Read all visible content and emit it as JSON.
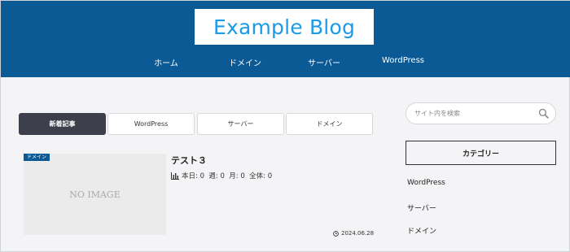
{
  "site": {
    "logo_text": "Example Blog",
    "nav": [
      "ホーム",
      "ドメイン",
      "サーバー",
      "WordPress"
    ]
  },
  "tabs": [
    {
      "label": "新着記事",
      "active": true
    },
    {
      "label": "WordPress",
      "active": false
    },
    {
      "label": "サーバー",
      "active": false
    },
    {
      "label": "ドメイン",
      "active": false
    }
  ],
  "post": {
    "category_badge": "ドメイン",
    "thumbnail_text": "NO IMAGE",
    "title": "テスト３",
    "stats": "本日: 0  週: 0  月: 0  全体: 0",
    "date": "2024.06.28"
  },
  "sidebar": {
    "search_placeholder": "サイト内を検索",
    "category_heading": "カテゴリー",
    "categories": [
      "WordPress",
      "サーバー",
      "ドメイン"
    ]
  },
  "colors": {
    "header_bg": "#0b5a95",
    "logo_text": "#1a9be6",
    "active_tab": "#3d3f4d"
  }
}
